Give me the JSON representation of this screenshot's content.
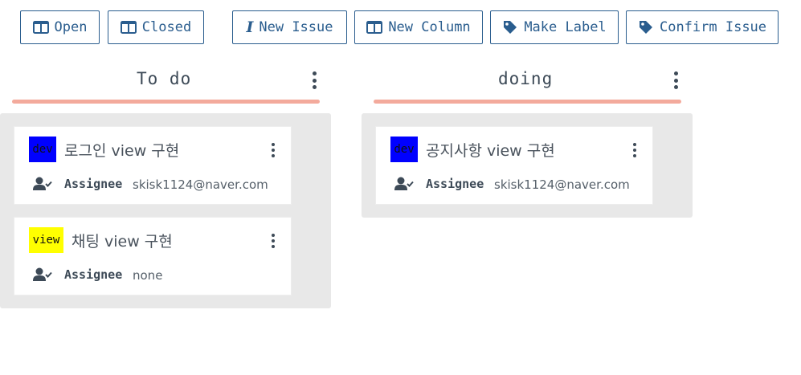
{
  "toolbar": {
    "open_label": "Open",
    "closed_label": "Closed",
    "new_issue_label": "New Issue",
    "new_column_label": "New Column",
    "make_label_label": "Make Label",
    "confirm_issue_label": "Confirm Issue"
  },
  "icons": {
    "open": "columns-icon",
    "closed": "columns-icon",
    "new_issue": "i-cursor-icon",
    "new_column": "columns-icon",
    "make_label": "tag-icon",
    "confirm_issue": "tag-icon",
    "assignee": "user-check-icon",
    "menu": "vertical-ellipsis-icon"
  },
  "colors": {
    "accent": "#2a5d8e",
    "column_underline": "#f3aa9c",
    "lane_background": "#e8e8e8",
    "label_dev": "#0000ff",
    "label_view": "#ffff00"
  },
  "columns": [
    {
      "title": "To do",
      "cards": [
        {
          "label": "dev",
          "title": "로그인 view 구현",
          "assignee_label": "Assignee",
          "assignee": "skisk1124@naver.com"
        },
        {
          "label": "view",
          "title": "채팅 view 구현",
          "assignee_label": "Assignee",
          "assignee": "none"
        }
      ]
    },
    {
      "title": "doing",
      "cards": [
        {
          "label": "dev",
          "title": "공지사항 view 구현",
          "assignee_label": "Assignee",
          "assignee": "skisk1124@naver.com"
        }
      ]
    }
  ]
}
